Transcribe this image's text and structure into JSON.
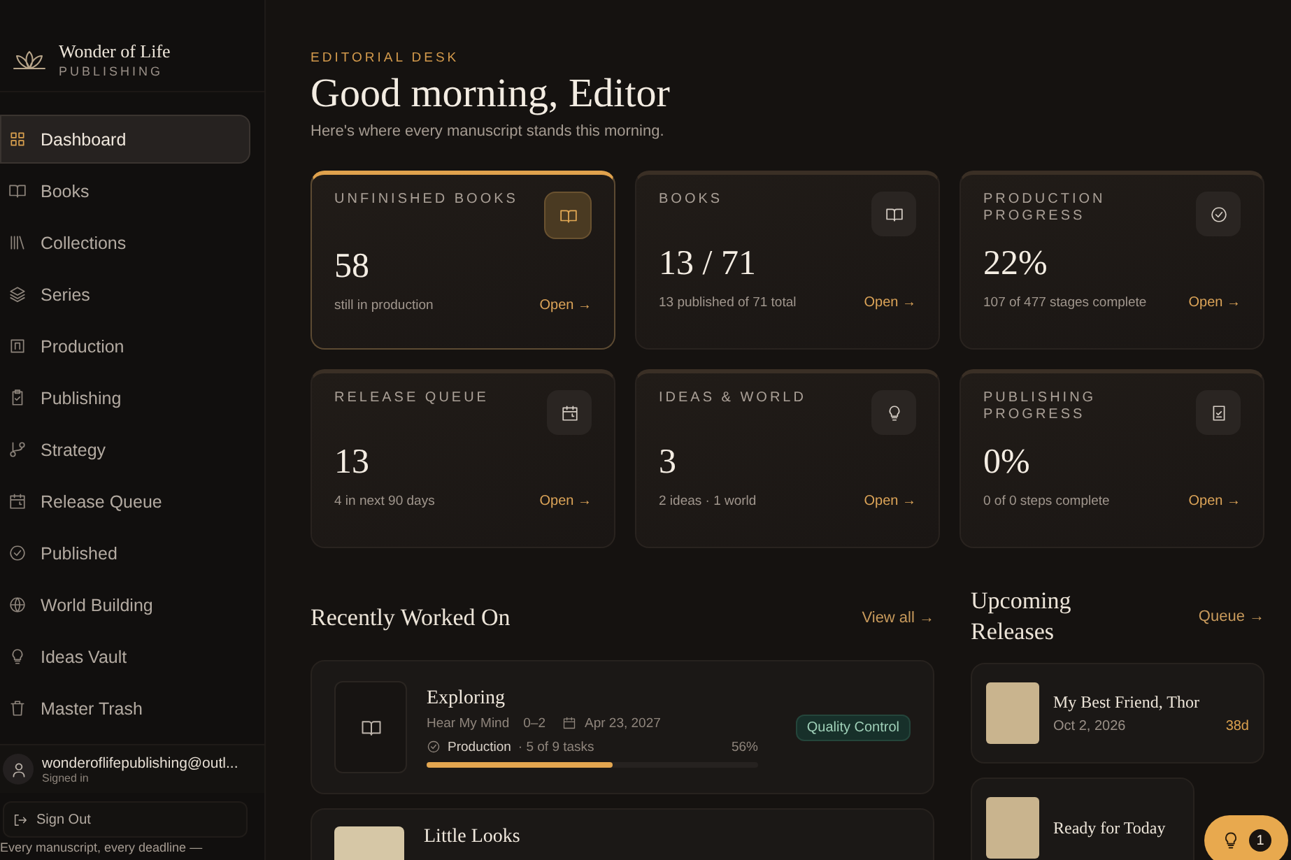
{
  "brand": {
    "name": "Wonder of Life",
    "subtitle": "PUBLISHING"
  },
  "nav": [
    {
      "label": "Dashboard",
      "kind": "grid",
      "selected": true
    },
    {
      "label": "Books",
      "kind": "book",
      "selected": false
    },
    {
      "label": "Collections",
      "kind": "shelves",
      "selected": false
    },
    {
      "label": "Series",
      "kind": "layers",
      "selected": false
    },
    {
      "label": "Production",
      "kind": "panel",
      "selected": false
    },
    {
      "label": "Publishing",
      "kind": "clipboard",
      "selected": false
    },
    {
      "label": "Strategy",
      "kind": "branch",
      "selected": false
    },
    {
      "label": "Release Queue",
      "kind": "calendar",
      "selected": false
    },
    {
      "label": "Published",
      "kind": "check",
      "selected": false
    },
    {
      "label": "World Building",
      "kind": "globe",
      "selected": false
    },
    {
      "label": "Ideas Vault",
      "kind": "bulb",
      "selected": false
    },
    {
      "label": "Master Trash",
      "kind": "trash",
      "selected": false
    }
  ],
  "user": {
    "email": "wonderoflifepublishing@outl...",
    "status": "Signed in"
  },
  "sign_out": "Sign Out",
  "footer": "Every manuscript, every deadline —",
  "header": {
    "eyebrow": "EDITORIAL DESK",
    "title": "Good morning, Editor",
    "subtitle": "Here's where every manuscript stands this morning."
  },
  "stats": [
    {
      "label": "UNFINISHED BOOKS",
      "value": "58",
      "caption": "still in production",
      "link": "Open →",
      "kind": "book",
      "selected": true
    },
    {
      "label": "BOOKS",
      "value": "13 / 71",
      "caption": "13 published of 71 total",
      "link": "Open →",
      "kind": "book",
      "selected": false
    },
    {
      "label": "PRODUCTION PROGRESS",
      "value": "22%",
      "caption": "107 of 477 stages complete",
      "link": "Open →",
      "kind": "check",
      "selected": false
    },
    {
      "label": "RELEASE QUEUE",
      "value": "13",
      "caption": "4 in next 90 days",
      "link": "Open →",
      "kind": "calendar",
      "selected": false
    },
    {
      "label": "IDEAS & WORLD",
      "value": "3",
      "caption": "2 ideas · 1 world",
      "link": "Open →",
      "kind": "bulb",
      "selected": false
    },
    {
      "label": "PUBLISHING PROGRESS",
      "value": "0%",
      "caption": "0 of 0 steps complete",
      "link": "Open →",
      "kind": "checklist",
      "selected": false
    }
  ],
  "recent": {
    "title": "Recently Worked On",
    "link": "View all →",
    "items": [
      {
        "kind": "full",
        "title": "Exploring",
        "series": "Hear My Mind",
        "number": "0–2",
        "date": "Apr 23, 2027",
        "stage": "Production",
        "tasks": "· 5 of 9 tasks",
        "percent": "56%",
        "level": 0.56,
        "status": "Quality Control"
      },
      {
        "kind": "cover",
        "title": "Little Looks"
      }
    ]
  },
  "upcoming": {
    "title": "Upcoming Releases",
    "link": "Queue →",
    "items": [
      {
        "title": "My Best Friend, Thor",
        "date": "Oct 2, 2026",
        "days": "38d"
      },
      {
        "title": "Ready for Today"
      }
    ]
  },
  "tips_badge": {
    "count": "1"
  }
}
